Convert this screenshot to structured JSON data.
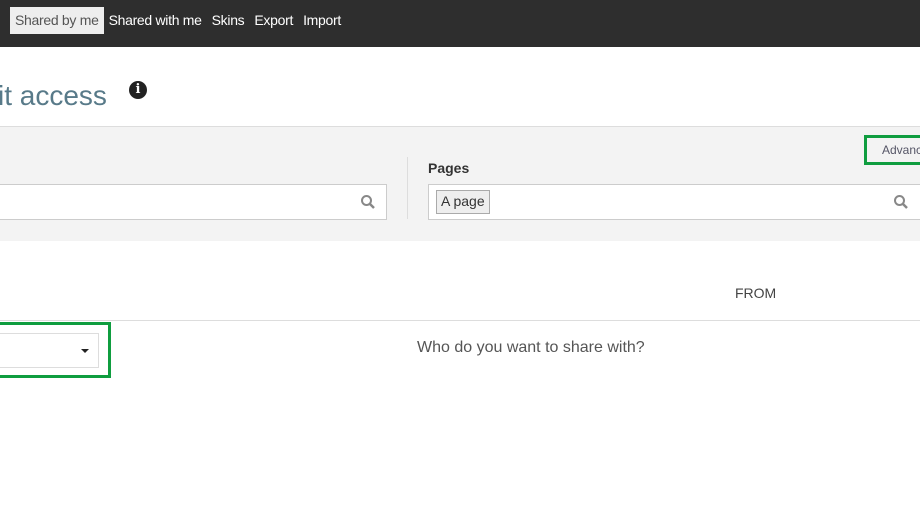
{
  "nav": {
    "items": [
      {
        "label": "Shared by me",
        "active": true
      },
      {
        "label": "Shared with me",
        "active": false
      },
      {
        "label": "Skins",
        "active": false
      },
      {
        "label": "Export",
        "active": false
      },
      {
        "label": "Import",
        "active": false
      }
    ]
  },
  "page": {
    "title": "it access",
    "info_icon": "info-circle-icon"
  },
  "filters": {
    "left_input_value": "",
    "pages_label": "Pages",
    "pages_tag": "A page",
    "advanced_label": "Advanced",
    "search_icon": "search-icon"
  },
  "table": {
    "from_header": "FROM"
  },
  "share": {
    "prompt": "Who do you want to share with?",
    "select_value": ""
  },
  "colors": {
    "topbar": "#2e2e2e",
    "highlight": "#0f9d3f",
    "title": "#587a89"
  }
}
